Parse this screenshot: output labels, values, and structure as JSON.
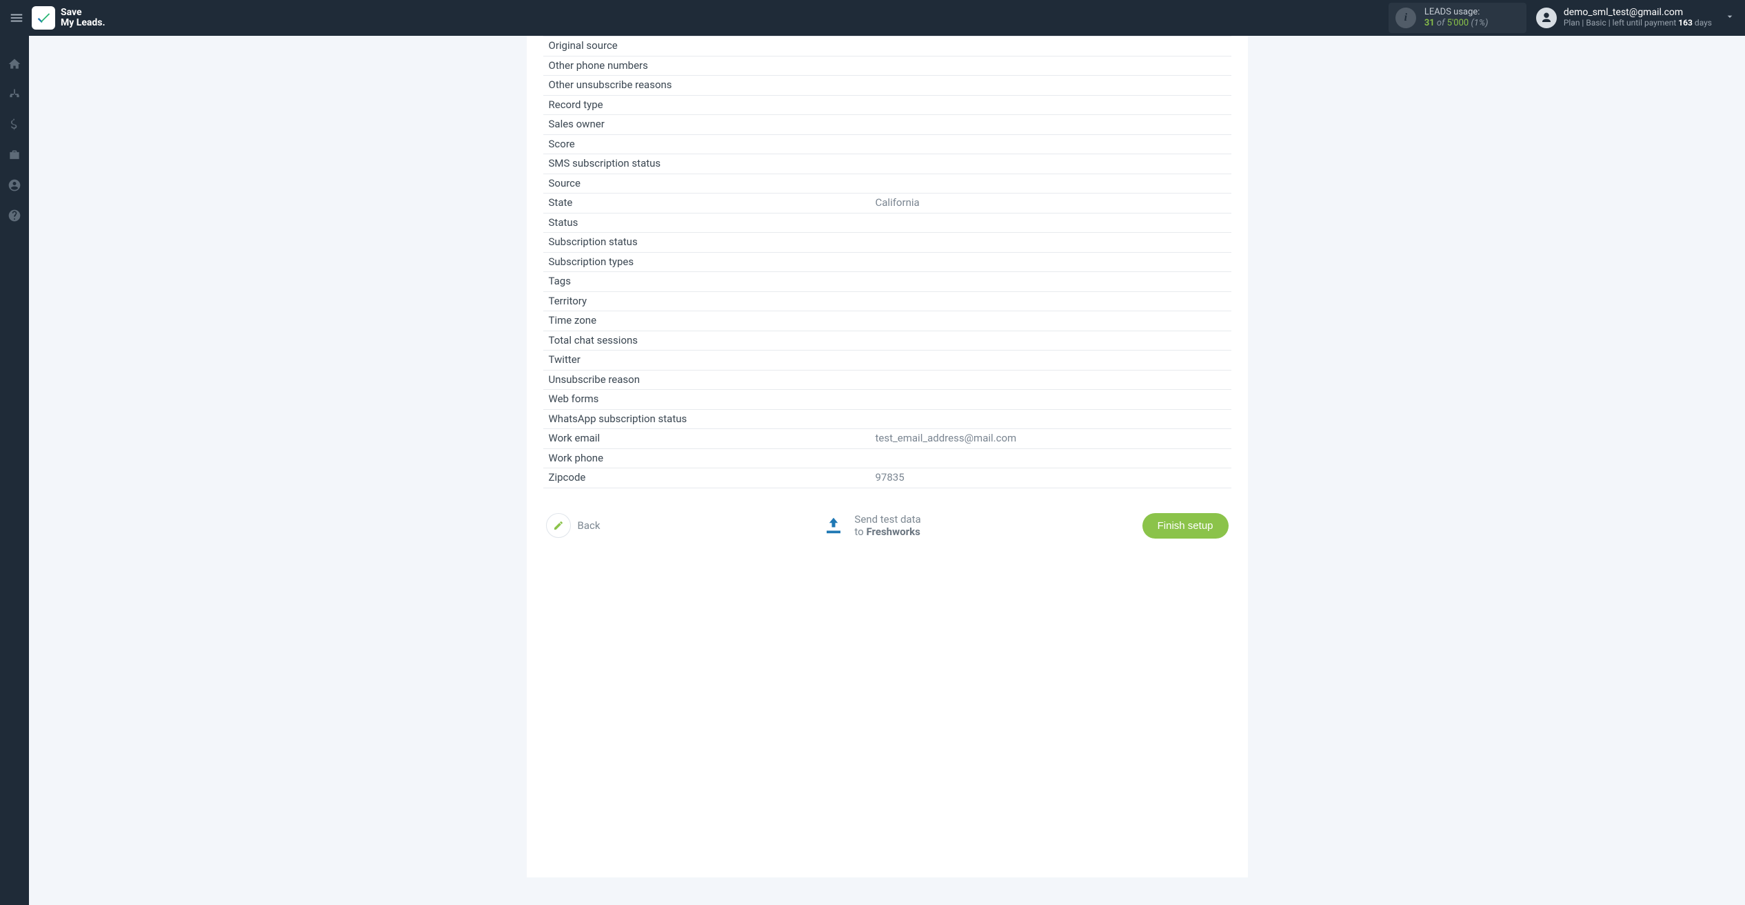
{
  "header": {
    "brand_line1": "Save",
    "brand_line2": "My Leads.",
    "usage": {
      "title": "LEADS usage:",
      "used": "31",
      "of_label": "of",
      "limit": "5'000",
      "percent": "(1%)"
    },
    "user": {
      "email": "demo_sml_test@gmail.com",
      "plan_prefix": "Plan |",
      "plan_name": "Basic",
      "plan_mid": "| left until payment",
      "days": "163",
      "days_suffix": "days"
    }
  },
  "sidebar_icons": [
    "home-icon",
    "sitemap-icon",
    "dollar-icon",
    "briefcase-icon",
    "user-circle-icon",
    "question-circle-icon"
  ],
  "rows": [
    {
      "label": "Original source",
      "value": ""
    },
    {
      "label": "Other phone numbers",
      "value": ""
    },
    {
      "label": "Other unsubscribe reasons",
      "value": ""
    },
    {
      "label": "Record type",
      "value": ""
    },
    {
      "label": "Sales owner",
      "value": ""
    },
    {
      "label": "Score",
      "value": ""
    },
    {
      "label": "SMS subscription status",
      "value": ""
    },
    {
      "label": "Source",
      "value": ""
    },
    {
      "label": "State",
      "value": "California"
    },
    {
      "label": "Status",
      "value": ""
    },
    {
      "label": "Subscription status",
      "value": ""
    },
    {
      "label": "Subscription types",
      "value": ""
    },
    {
      "label": "Tags",
      "value": ""
    },
    {
      "label": "Territory",
      "value": ""
    },
    {
      "label": "Time zone",
      "value": ""
    },
    {
      "label": "Total chat sessions",
      "value": ""
    },
    {
      "label": "Twitter",
      "value": ""
    },
    {
      "label": "Unsubscribe reason",
      "value": ""
    },
    {
      "label": "Web forms",
      "value": ""
    },
    {
      "label": "WhatsApp subscription status",
      "value": ""
    },
    {
      "label": "Work email",
      "value": "test_email_address@mail.com"
    },
    {
      "label": "Work phone",
      "value": ""
    },
    {
      "label": "Zipcode",
      "value": "97835"
    }
  ],
  "footer": {
    "back_label": "Back",
    "send_line1": "Send test data",
    "send_line2_prefix": "to",
    "send_line2_bold": "Freshworks",
    "finish_label": "Finish setup"
  }
}
